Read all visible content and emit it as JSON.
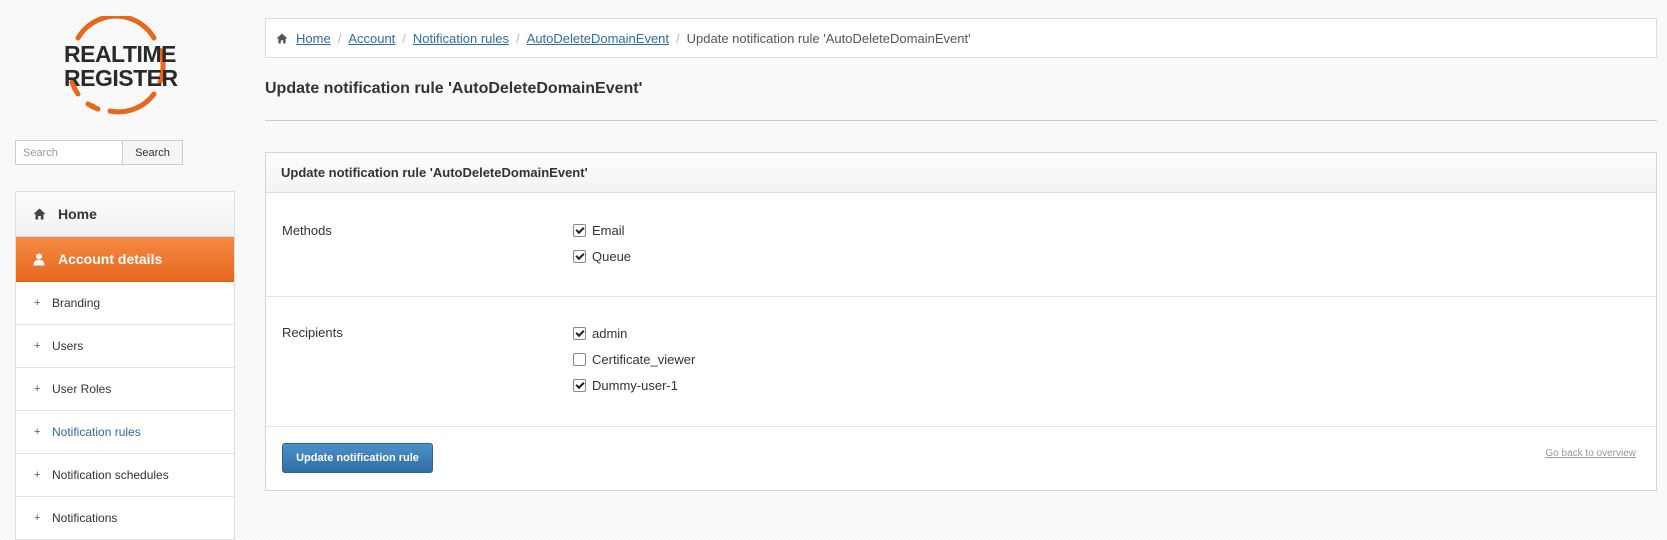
{
  "brand": {
    "logo_text": "REALTIME REGISTER",
    "accent_color": "#e8671c",
    "link_color": "#2c6ca8"
  },
  "search": {
    "placeholder": "Search",
    "button_label": "Search"
  },
  "sidebar": {
    "items": [
      {
        "label": "Home",
        "icon": "home-icon",
        "type": "main",
        "active": false
      },
      {
        "label": "Account details",
        "icon": "user-icon",
        "type": "main",
        "active": true
      },
      {
        "label": "Branding",
        "icon": "plus-icon",
        "type": "sub"
      },
      {
        "label": "Users",
        "icon": "plus-icon",
        "type": "sub"
      },
      {
        "label": "User Roles",
        "icon": "plus-icon",
        "type": "sub"
      },
      {
        "label": "Notification rules",
        "icon": "plus-icon",
        "type": "sub",
        "current": true
      },
      {
        "label": "Notification schedules",
        "icon": "plus-icon",
        "type": "sub"
      },
      {
        "label": "Notifications",
        "icon": "plus-icon",
        "type": "sub"
      }
    ]
  },
  "breadcrumb": {
    "links": [
      "Home",
      "Account",
      "Notification rules",
      "AutoDeleteDomainEvent"
    ],
    "current": "Update notification rule 'AutoDeleteDomainEvent'"
  },
  "page": {
    "title": "Update notification rule 'AutoDeleteDomainEvent'"
  },
  "panel": {
    "title": "Update notification rule 'AutoDeleteDomainEvent'",
    "methods": {
      "label": "Methods",
      "options": [
        {
          "label": "Email",
          "checked": true
        },
        {
          "label": "Queue",
          "checked": true
        }
      ]
    },
    "recipients": {
      "label": "Recipients",
      "options": [
        {
          "label": "admin",
          "checked": true
        },
        {
          "label": "Certificate_viewer",
          "checked": false
        },
        {
          "label": "Dummy-user-1",
          "checked": true
        }
      ]
    },
    "submit_label": "Update notification rule",
    "back_label": "Go back to overview"
  }
}
